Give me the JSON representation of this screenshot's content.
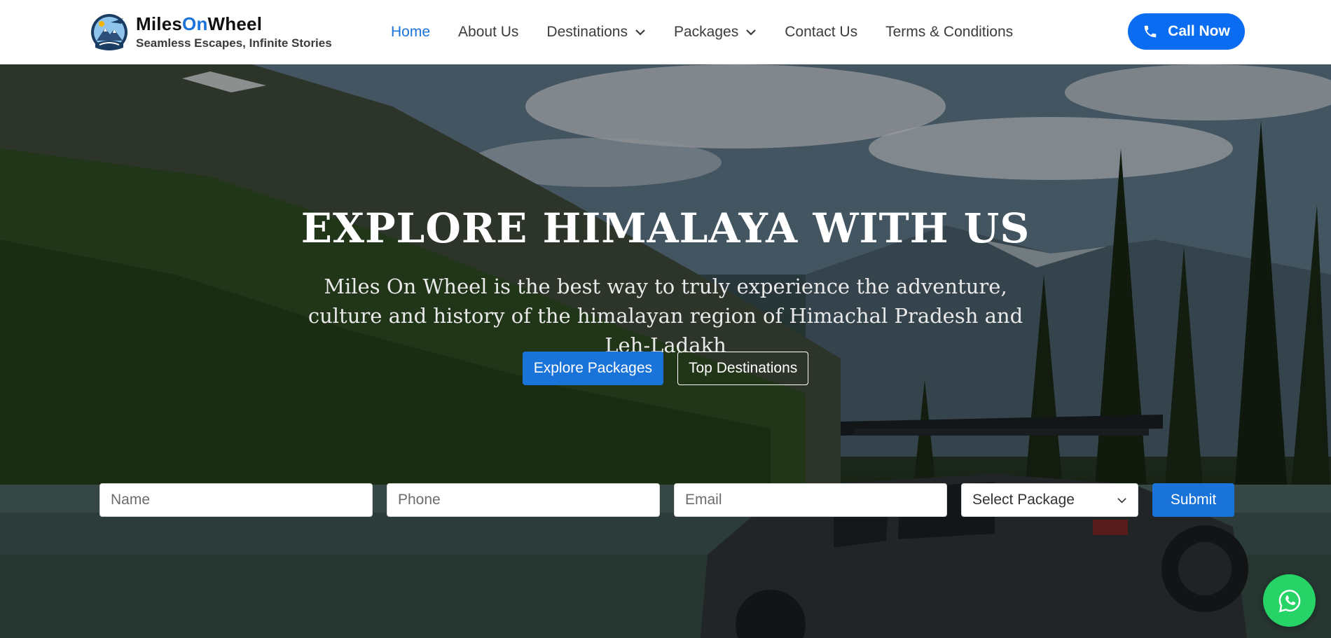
{
  "brand": {
    "name_part1": "Miles",
    "name_part2": "On",
    "name_part3": "Wheel",
    "tagline": "Seamless Escapes, Infinite Stories",
    "logo_icon": "mountain-plane-logo-icon"
  },
  "nav": {
    "items": [
      {
        "label": "Home",
        "active": true
      },
      {
        "label": "About Us"
      },
      {
        "label": "Destinations",
        "dropdown": true
      },
      {
        "label": "Packages",
        "dropdown": true
      },
      {
        "label": "Contact Us"
      },
      {
        "label": "Terms & Conditions"
      }
    ]
  },
  "call": {
    "label": "Call Now",
    "icon": "phone-icon"
  },
  "hero": {
    "title": "EXPLORE HIMALAYA WITH US",
    "subtitle": "Miles On Wheel is the best way to truly experience the adventure, culture and history of the himalayan region of Himachal Pradesh and Leh-Ladakh",
    "primary_button": "Explore Packages",
    "secondary_button": "Top Destinations"
  },
  "form": {
    "name_placeholder": "Name",
    "phone_placeholder": "Phone",
    "email_placeholder": "Email",
    "package_select": "Select Package",
    "submit_label": "Submit"
  },
  "whatsapp": {
    "icon": "whatsapp-icon"
  },
  "colors": {
    "accent": "#1a73d9",
    "call_button": "#0a6cf0",
    "whatsapp": "#25d366"
  }
}
